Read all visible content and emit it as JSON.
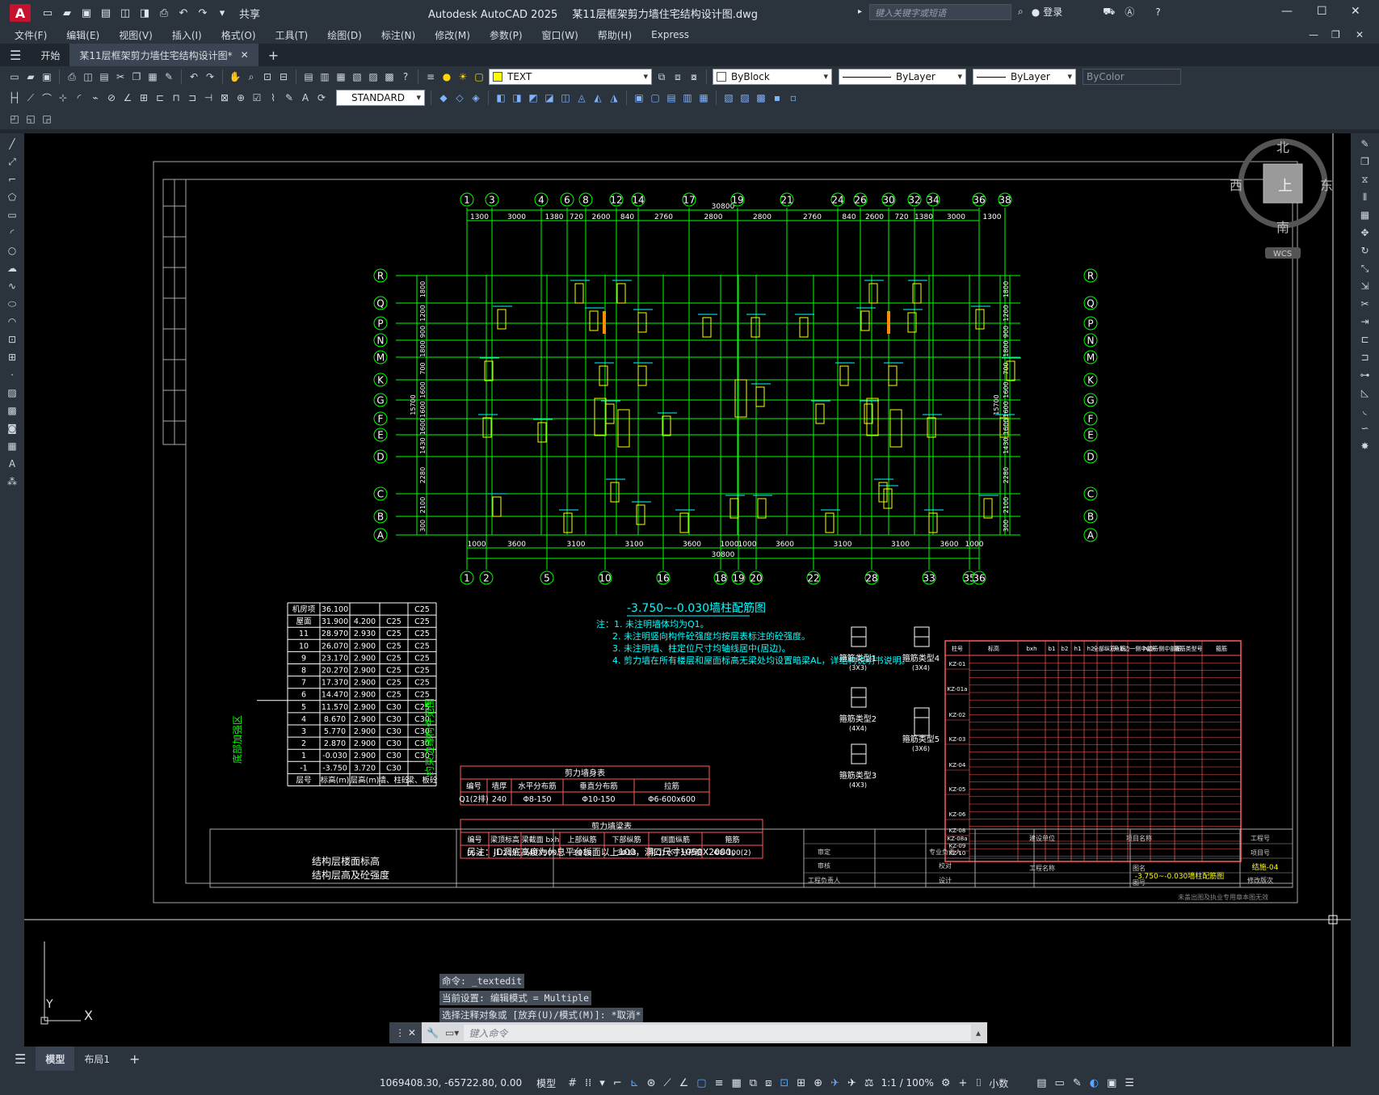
{
  "app": {
    "title": "Autodesk AutoCAD 2025",
    "document": "某11层框架剪力墙住宅结构设计图.dwg",
    "share_label": "共享",
    "search_placeholder": "键入关键字或短语",
    "login_label": "登录"
  },
  "menu": [
    "文件(F)",
    "编辑(E)",
    "视图(V)",
    "插入(I)",
    "格式(O)",
    "工具(T)",
    "绘图(D)",
    "标注(N)",
    "修改(M)",
    "参数(P)",
    "窗口(W)",
    "帮助(H)",
    "Express"
  ],
  "tabs": {
    "start": "开始",
    "active": "某11层框架剪力墙住宅结构设计图*"
  },
  "toolbar": {
    "layer": "TEXT",
    "color": "ByBlock",
    "linetype": "ByLayer",
    "lineweight": "ByLayer",
    "plotstyle": "ByColor",
    "textstyle": "STANDARD"
  },
  "viewcube": {
    "n": "北",
    "s": "南",
    "e": "东",
    "w": "西",
    "top": "上",
    "wcs": "WCS"
  },
  "plan": {
    "top_axes": [
      "1",
      "3",
      "4",
      "6",
      "8",
      "12",
      "14",
      "17",
      "19",
      "21",
      "24",
      "26",
      "30",
      "32",
      "34",
      "36",
      "38"
    ],
    "top_dims": [
      "1300",
      "3000",
      "1380",
      "720",
      "2600",
      "840",
      "2760",
      "2800",
      "2800",
      "2760",
      "840",
      "2600",
      "720",
      "1380",
      "3000",
      "1300"
    ],
    "bottom_axes": [
      "1",
      "2",
      "5",
      "10",
      "16",
      "18",
      "19",
      "20",
      "22",
      "28",
      "33",
      "35",
      "36"
    ],
    "bottom_dims": [
      "1000",
      "3600",
      "3100",
      "3100",
      "3600",
      "1000",
      "1000",
      "3600",
      "3100",
      "3100",
      "3600",
      "1000"
    ],
    "total": "30800",
    "row_axes": [
      "R",
      "Q",
      "P",
      "N",
      "M",
      "K",
      "G",
      "F",
      "E",
      "D",
      "C",
      "B",
      "A"
    ],
    "row_dims": [
      "1800",
      "1200",
      "900",
      "1800",
      "700",
      "1600",
      "1600",
      "1600",
      "1430",
      "2280",
      "2100",
      "300"
    ],
    "total_v": "15700"
  },
  "drawing_title": "-3.750~-0.030墙柱配筋图",
  "notes": [
    "注：1. 未注明墙体均为Q1。",
    "2. 未注明竖向构件砼强度均按层表标注的砼强度。",
    "3. 未注明墙、柱定位尺寸均轴线居中(居边)。",
    "4. 剪力墙在所有楼层和屋面标高无梁处均设置暗梁AL，详结构说明书说明。"
  ],
  "floor_table": {
    "rows": [
      [
        "机房项",
        "36.100",
        "",
        "",
        "C25"
      ],
      [
        "屋面",
        "31.900",
        "4.200",
        "C25",
        "C25"
      ],
      [
        "11",
        "28.970",
        "2.930",
        "C25",
        "C25"
      ],
      [
        "10",
        "26.070",
        "2.900",
        "C25",
        "C25"
      ],
      [
        "9",
        "23.170",
        "2.900",
        "C25",
        "C25"
      ],
      [
        "8",
        "20.270",
        "2.900",
        "C25",
        "C25"
      ],
      [
        "7",
        "17.370",
        "2.900",
        "C25",
        "C25"
      ],
      [
        "6",
        "14.470",
        "2.900",
        "C25",
        "C25"
      ],
      [
        "5",
        "11.570",
        "2.900",
        "C30",
        "C25"
      ],
      [
        "4",
        "8.670",
        "2.900",
        "C30",
        "C30"
      ],
      [
        "3",
        "5.770",
        "2.900",
        "C30",
        "C30"
      ],
      [
        "2",
        "2.870",
        "2.900",
        "C30",
        "C30"
      ],
      [
        "1",
        "-0.030",
        "2.900",
        "C30",
        "C30"
      ],
      [
        "-1",
        "-3.750",
        "3.720",
        "C30",
        ""
      ]
    ],
    "header": [
      "层号",
      "标高(m)",
      "层高(m)",
      "墙、柱砼",
      "梁、板砼"
    ],
    "caption1": "结构层楼面标高",
    "caption2": "结构层高及砼强度",
    "side_left": "底部加强区",
    "side_right": "约束边缘构件范围"
  },
  "wall_table": {
    "title": "剪力墙身表",
    "header": [
      "编号",
      "墙厚",
      "水平分布筋",
      "垂直分布筋",
      "拉筋"
    ],
    "row": [
      "Q1(2排)",
      "240",
      "Φ8-150",
      "Φ10-150",
      "Φ6-600x600"
    ]
  },
  "beam_table": {
    "title": "剪力墙梁表",
    "header": [
      "编号",
      "梁顶标高",
      "梁截面 bxh",
      "上部纵筋",
      "下部纵筋",
      "侧面纵筋",
      "箍筋"
    ],
    "row": [
      "LL-a",
      "-1.219",
      "240X500",
      "3Φ18",
      "3Φ18",
      "同Q1水平分布筋",
      "Φ8-100(2)"
    ],
    "note": "另注：JD洞底高度为休息平台板面以上100，洞口尺寸1050X2000。"
  },
  "stirrups": [
    "箍筋类型1",
    "箍筋类型2",
    "箍筋类型3",
    "箍筋类型4",
    "箍筋类型5"
  ],
  "stirrup_sub": [
    "(3X3)",
    "(4X4)",
    "(4X3)",
    "(3X4)",
    "(3X6)"
  ],
  "col_table": {
    "header": [
      "柱号",
      "标高",
      "bxh",
      "b1",
      "b2",
      "h1",
      "h2",
      "全部纵筋",
      "角筋",
      "b边一侧中部筋",
      "h边一侧中部筋",
      "箍筋类型号",
      "箍筋"
    ],
    "ids": [
      "KZ-01",
      "KZ-01a",
      "KZ-02",
      "KZ-03",
      "KZ-04",
      "KZ-05",
      "KZ-06",
      "KZ-08",
      "KZ-08a",
      "KZ-09",
      "KZ-10"
    ]
  },
  "titleblock": {
    "drawing": "-3.750~-0.030墙柱配筋图",
    "number": "结施-04",
    "cells": [
      "审定",
      "审核",
      "工程负责人",
      "专业负责人",
      "校对",
      "设计",
      "建设单位",
      "工程名称",
      "项目名称",
      "图名",
      "图号",
      "工程号",
      "项目号",
      "修改版次"
    ],
    "footer": "未盖出图及执业专用章本图无效"
  },
  "command": {
    "lines": [
      "命令: _textedit",
      "当前设置: 编辑模式 = Multiple",
      "选择注释对象或 [放弃(U)/模式(M)]: *取消*"
    ],
    "placeholder": "键入命令"
  },
  "ucs": {
    "x": "X",
    "y": "Y"
  },
  "layouts": {
    "model": "模型",
    "layout1": "布局1"
  },
  "status": {
    "coords": "1069408.30, -65722.80, 0.00",
    "mode": "模型",
    "scale": "1:1 / 100%",
    "units": "小数"
  },
  "colors": {
    "grid": "#00ff00",
    "text": "#00ffff",
    "wall": "#ffff00",
    "accent": "#ff5a5a",
    "hatch": "#ff8c00"
  }
}
